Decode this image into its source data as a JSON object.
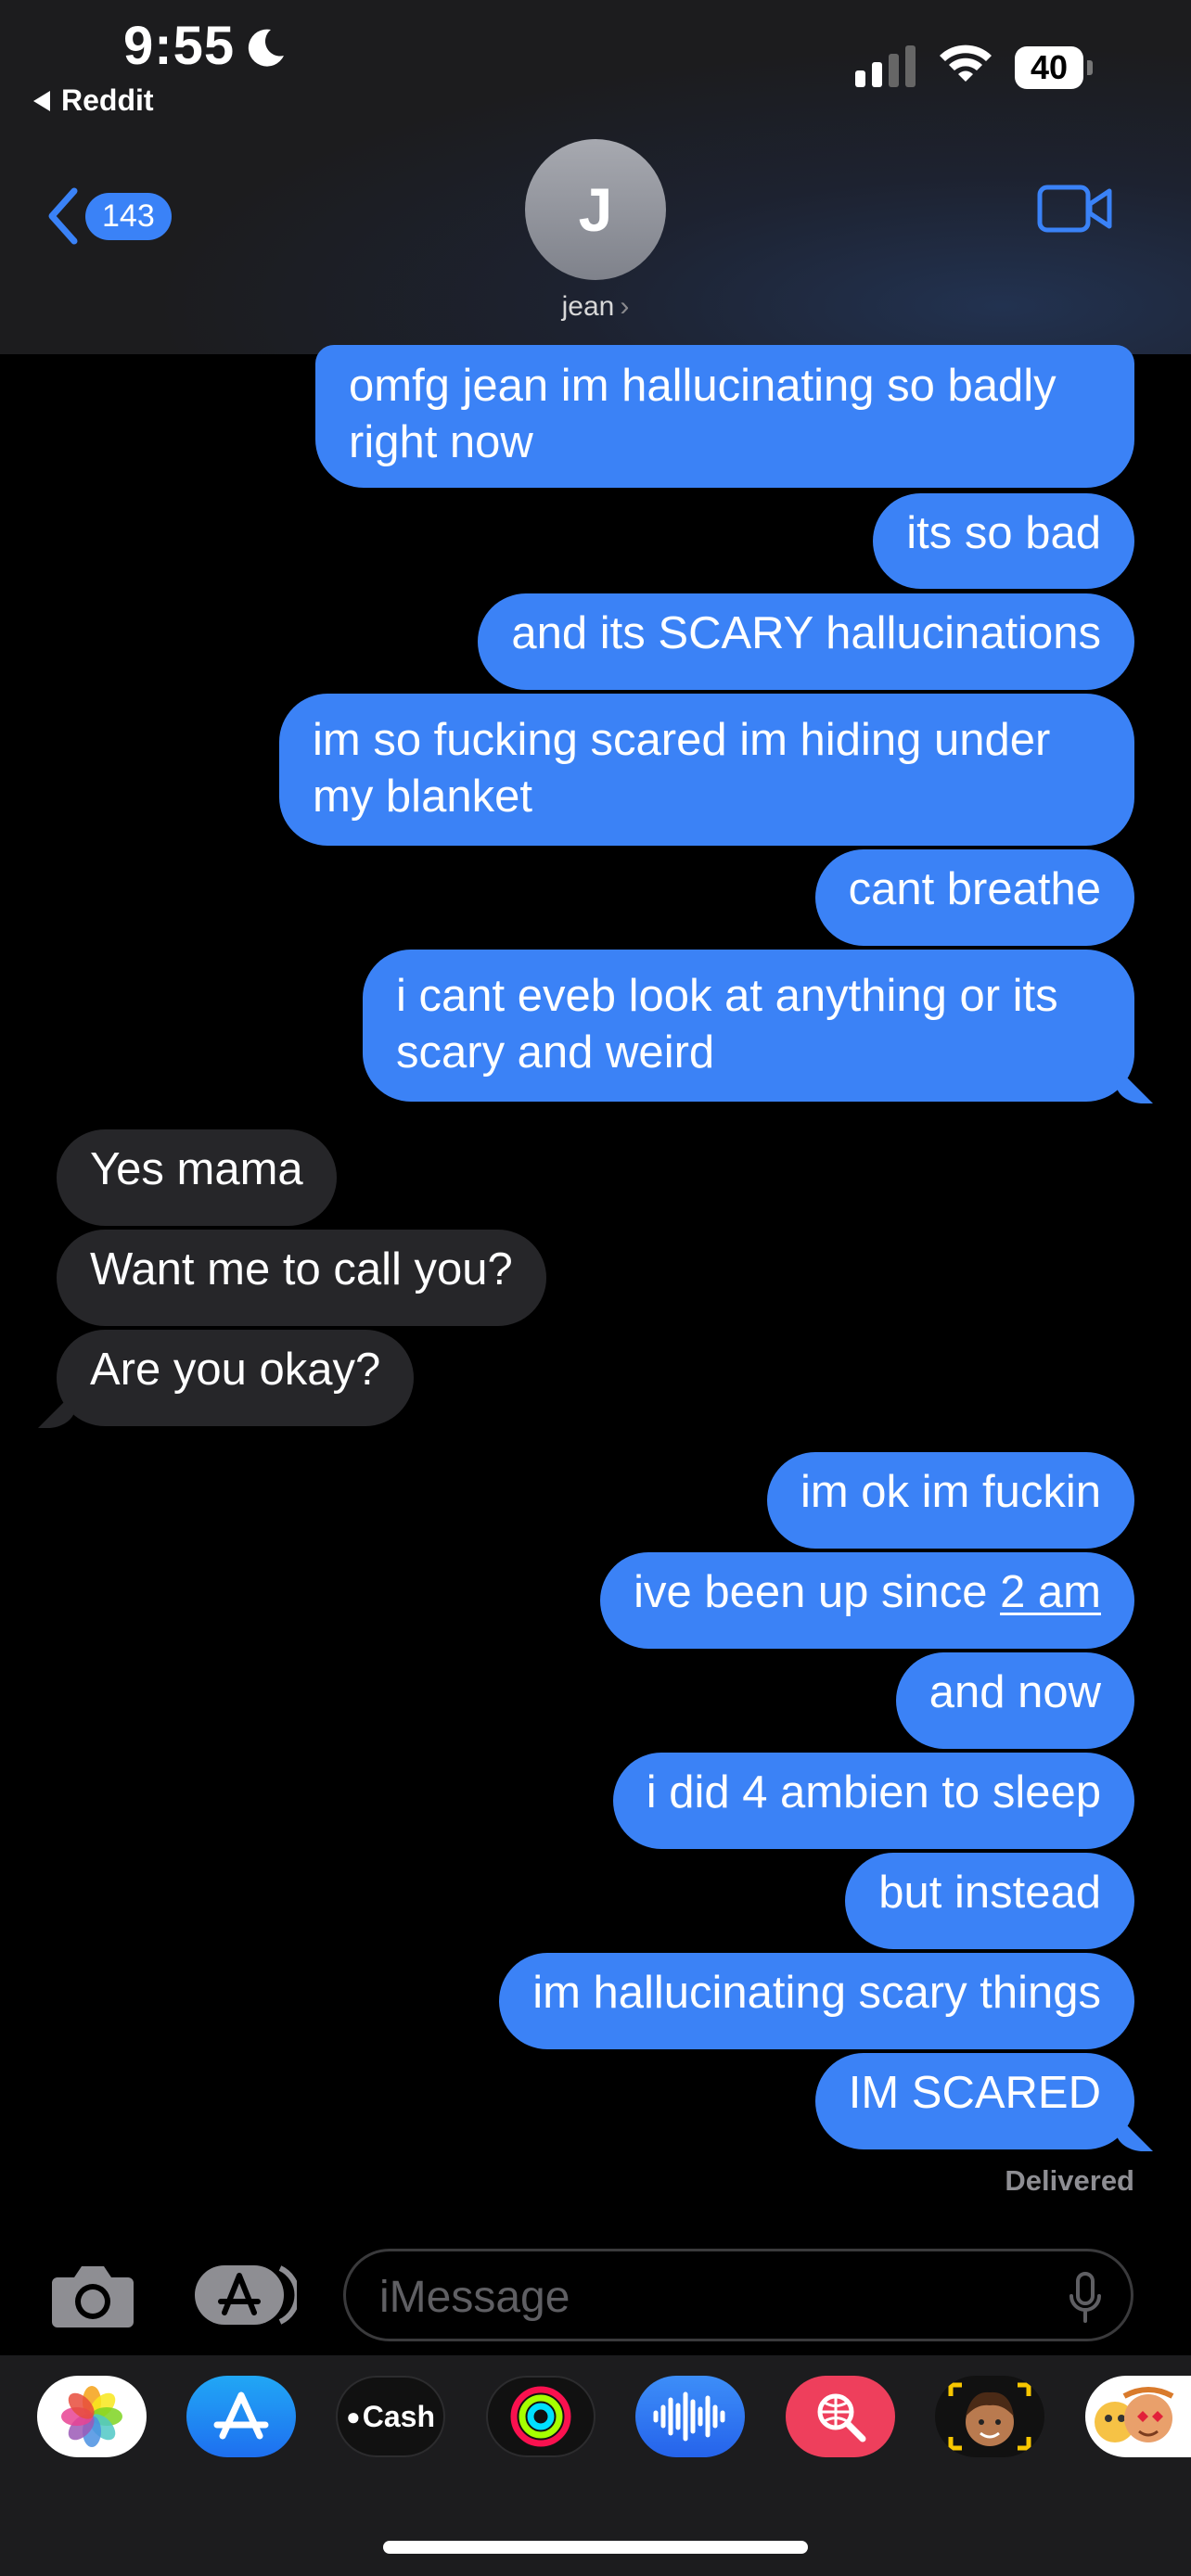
{
  "status_bar": {
    "time": "9:55",
    "back_app": "Reddit",
    "battery": "40"
  },
  "header": {
    "back_count": "143",
    "avatar_initial": "J",
    "contact_name": "jean"
  },
  "messages": [
    {
      "text": "omfg jean im hallucinating so badly",
      "text2": "right now",
      "direction": "outgoing"
    },
    {
      "text": "its so bad",
      "direction": "outgoing"
    },
    {
      "text": "and its SCARY hallucinations",
      "direction": "outgoing"
    },
    {
      "text": "im so fucking scared im hiding under",
      "text2": "my blanket",
      "direction": "outgoing"
    },
    {
      "text": "cant breathe",
      "direction": "outgoing"
    },
    {
      "text": "i cant eveb look at anything or its",
      "text2": "scary and weird",
      "direction": "outgoing"
    },
    {
      "text": "Yes mama",
      "direction": "incoming"
    },
    {
      "text": "Want me to call you?",
      "direction": "incoming"
    },
    {
      "text": "Are you okay?",
      "direction": "incoming"
    },
    {
      "text": "im ok im fuckin",
      "direction": "outgoing"
    },
    {
      "text": "ive been up since ",
      "link": "2 am",
      "direction": "outgoing"
    },
    {
      "text": "and now",
      "direction": "outgoing"
    },
    {
      "text": "i did 4 ambien to sleep",
      "direction": "outgoing"
    },
    {
      "text": "but instead",
      "direction": "outgoing"
    },
    {
      "text": "im hallucinating scary things",
      "direction": "outgoing"
    },
    {
      "text": "IM SCARED",
      "direction": "outgoing"
    }
  ],
  "delivered_label": "Delivered",
  "input": {
    "placeholder": "iMessage"
  },
  "app_drawer": [
    {
      "name": "photos-app-icon"
    },
    {
      "name": "app-store-icon"
    },
    {
      "name": "apple-cash-icon",
      "label": "Cash"
    },
    {
      "name": "fitness-icon"
    },
    {
      "name": "audio-message-icon"
    },
    {
      "name": "image-search-icon"
    },
    {
      "name": "memoji-icon"
    },
    {
      "name": "animoji-icon"
    }
  ],
  "colors": {
    "outgoing_bubble": "#3b82f6",
    "incoming_bubble": "#262629",
    "background": "#000000"
  }
}
